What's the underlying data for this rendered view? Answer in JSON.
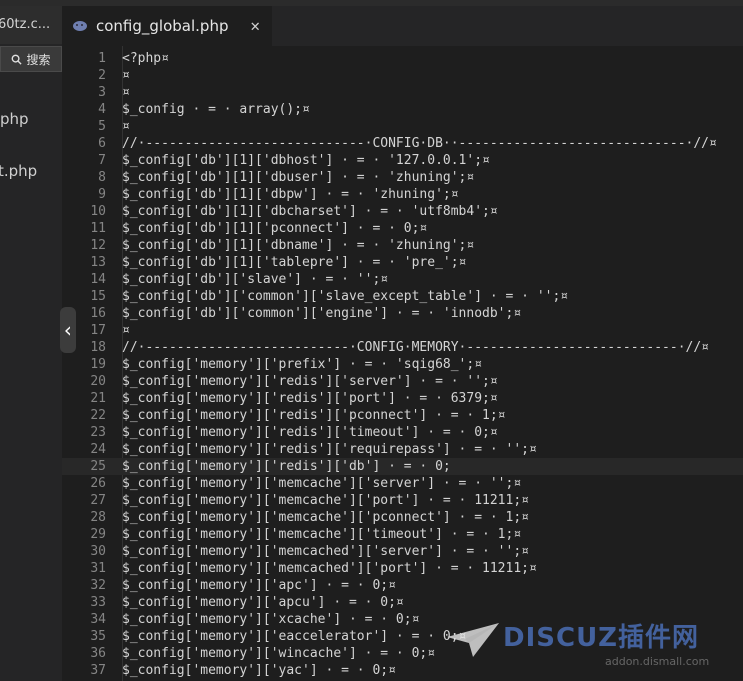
{
  "sidebar": {
    "top_tab_label": "60tz.c...",
    "search_label": "搜索",
    "files": [
      "php",
      "t.php"
    ]
  },
  "tabs": [
    {
      "label": "config_global.php",
      "active": true
    }
  ],
  "editor": {
    "current_line": 25,
    "lines": [
      "<?php¤",
      "¤",
      "¤",
      "$_config · = · array();¤",
      "¤",
      "//·----------------------------·CONFIG·DB··-----------------------------·//¤",
      "$_config['db'][1]['dbhost'] · = · '127.0.0.1';¤",
      "$_config['db'][1]['dbuser'] · = · 'zhuning';¤",
      "$_config['db'][1]['dbpw'] · = · 'zhuning';¤",
      "$_config['db'][1]['dbcharset'] · = · 'utf8mb4';¤",
      "$_config['db'][1]['pconnect'] · = · 0;¤",
      "$_config['db'][1]['dbname'] · = · 'zhuning';¤",
      "$_config['db'][1]['tablepre'] · = · 'pre_';¤",
      "$_config['db']['slave'] · = · '';¤",
      "$_config['db']['common']['slave_except_table'] · = · '';¤",
      "$_config['db']['common']['engine'] · = · 'innodb';¤",
      "¤",
      "//·--------------------------·CONFIG·MEMORY·---------------------------·//¤",
      "$_config['memory']['prefix'] · = · 'sqig68_';¤",
      "$_config['memory']['redis']['server'] · = · '';¤",
      "$_config['memory']['redis']['port'] · = · 6379;¤",
      "$_config['memory']['redis']['pconnect'] · = · 1;¤",
      "$_config['memory']['redis']['timeout'] · = · 0;¤",
      "$_config['memory']['redis']['requirepass'] · = · '';¤",
      "$_config['memory']['redis']['db'] · = · 0;",
      "$_config['memory']['memcache']['server'] · = · '';¤",
      "$_config['memory']['memcache']['port'] · = · 11211;¤",
      "$_config['memory']['memcache']['pconnect'] · = · 1;¤",
      "$_config['memory']['memcache']['timeout'] · = · 1;¤",
      "$_config['memory']['memcached']['server'] · = · '';¤",
      "$_config['memory']['memcached']['port'] · = · 11211;¤",
      "$_config['memory']['apc'] · = · 0;¤",
      "$_config['memory']['apcu'] · = · 0;¤",
      "$_config['memory']['xcache'] · = · 0;¤",
      "$_config['memory']['eaccelerator'] · = · 0;¤",
      "$_config['memory']['wincache'] · = · 0;¤",
      "$_config['memory']['yac'] · = · 0;¤"
    ]
  },
  "watermark": {
    "brand": "DISCUZ插件网",
    "sub": "addon.dismall.com"
  },
  "colors": {
    "background": "#1e1e1e",
    "sidebar": "#252526",
    "line_number": "#858585",
    "text": "#d4d4d4"
  }
}
